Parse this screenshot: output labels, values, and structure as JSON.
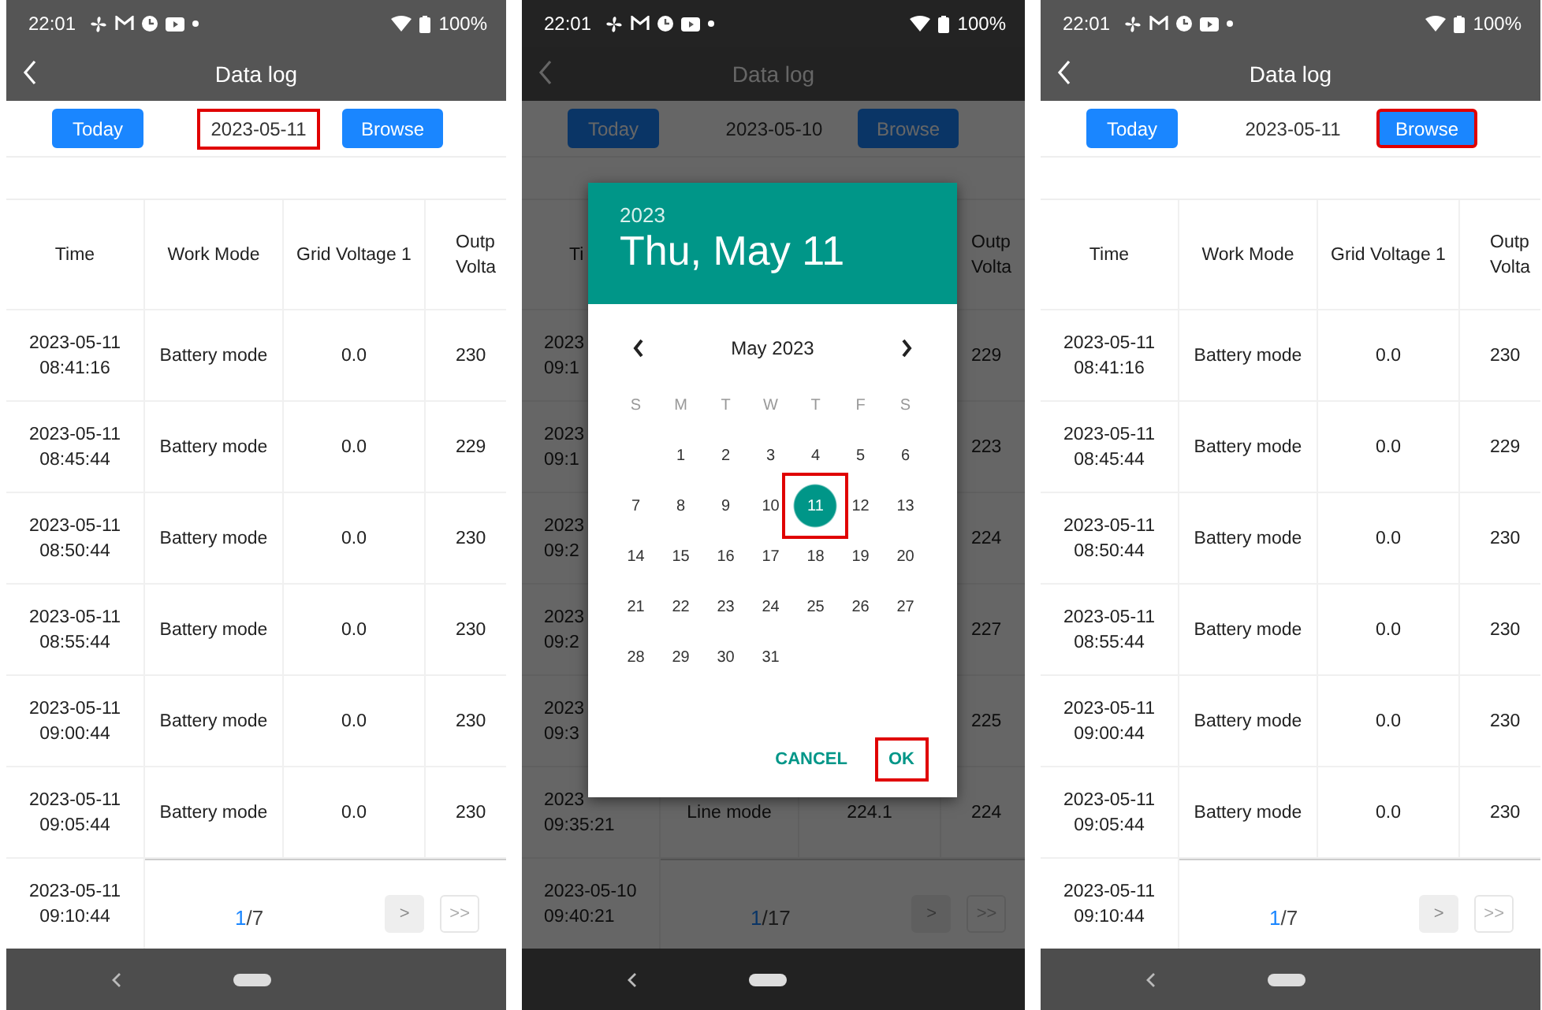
{
  "panels": [
    {
      "dimmed": false,
      "status": {
        "time": "22:01",
        "battery": "100%"
      },
      "title": "Data log",
      "toolbar": {
        "today": "Today",
        "date": "2023-05-11",
        "date_highlighted": true,
        "browse": "Browse",
        "browse_highlighted": false
      },
      "header": {
        "time": "Time",
        "work_mode": "Work Mode",
        "grid_voltage_1": "Grid Voltage 1",
        "output_voltage": [
          "Outp",
          "Volta"
        ]
      },
      "rows": [
        {
          "time": [
            "2023-05-11",
            "08:41:16"
          ],
          "work_mode": "Battery mode",
          "grid_voltage_1": "0.0",
          "output_voltage": "230"
        },
        {
          "time": [
            "2023-05-11",
            "08:45:44"
          ],
          "work_mode": "Battery mode",
          "grid_voltage_1": "0.0",
          "output_voltage": "229"
        },
        {
          "time": [
            "2023-05-11",
            "08:50:44"
          ],
          "work_mode": "Battery mode",
          "grid_voltage_1": "0.0",
          "output_voltage": "230"
        },
        {
          "time": [
            "2023-05-11",
            "08:55:44"
          ],
          "work_mode": "Battery mode",
          "grid_voltage_1": "0.0",
          "output_voltage": "230"
        },
        {
          "time": [
            "2023-05-11",
            "09:00:44"
          ],
          "work_mode": "Battery mode",
          "grid_voltage_1": "0.0",
          "output_voltage": "230"
        },
        {
          "time": [
            "2023-05-11",
            "09:05:44"
          ],
          "work_mode": "Battery mode",
          "grid_voltage_1": "0.0",
          "output_voltage": "230"
        }
      ],
      "last_row": {
        "time": [
          "2023-05-11",
          "09:10:44"
        ]
      },
      "pagination": {
        "current": "1",
        "total": "/7",
        "next": ">",
        "last": ">>"
      }
    },
    {
      "dimmed": true,
      "status": {
        "time": "22:01",
        "battery": "100%"
      },
      "title": "Data log",
      "toolbar": {
        "today": "Today",
        "date": "2023-05-10",
        "date_highlighted": false,
        "browse": "Browse",
        "browse_highlighted": false
      },
      "header": {
        "time": "Ti",
        "output_voltage": [
          "Outp",
          "Volta"
        ]
      },
      "rows": [
        {
          "time": [
            "2023",
            "09:1"
          ],
          "output_voltage": "229"
        },
        {
          "time": [
            "2023",
            "09:1"
          ],
          "output_voltage": "223"
        },
        {
          "time": [
            "2023",
            "09:2"
          ],
          "output_voltage": "224"
        },
        {
          "time": [
            "2023",
            "09:2"
          ],
          "output_voltage": "227"
        },
        {
          "time": [
            "2023",
            "09:3"
          ],
          "output_voltage": "225"
        },
        {
          "time": [
            "2023",
            "09:35:21"
          ],
          "work_mode": "Line mode",
          "grid_voltage_1": "224.1",
          "output_voltage": "224"
        }
      ],
      "last_row": {
        "time": [
          "2023-05-10",
          "09:40:21"
        ]
      },
      "pagination": {
        "current": "1",
        "total": "/17",
        "next": ">",
        "last": ">>"
      },
      "dialog": {
        "year": "2023",
        "date": "Thu, May 11",
        "month": "May 2023",
        "weekdays": [
          "S",
          "M",
          "T",
          "W",
          "T",
          "F",
          "S"
        ],
        "days": [
          {
            "label": "1",
            "selected": false,
            "highlighted": false
          },
          {
            "label": "2",
            "selected": false,
            "highlighted": false
          },
          {
            "label": "3",
            "selected": false,
            "highlighted": false
          },
          {
            "label": "4",
            "selected": false,
            "highlighted": false
          },
          {
            "label": "5",
            "selected": false,
            "highlighted": false
          },
          {
            "label": "6",
            "selected": false,
            "highlighted": false
          },
          {
            "label": "7",
            "selected": false,
            "highlighted": false
          },
          {
            "label": "8",
            "selected": false,
            "highlighted": false
          },
          {
            "label": "9",
            "selected": false,
            "highlighted": false
          },
          {
            "label": "10",
            "selected": false,
            "highlighted": false
          },
          {
            "label": "11",
            "selected": true,
            "highlighted": true
          },
          {
            "label": "12",
            "selected": false,
            "highlighted": false
          },
          {
            "label": "13",
            "selected": false,
            "highlighted": false
          },
          {
            "label": "14",
            "selected": false,
            "highlighted": false
          },
          {
            "label": "15",
            "selected": false,
            "highlighted": false
          },
          {
            "label": "16",
            "selected": false,
            "highlighted": false
          },
          {
            "label": "17",
            "selected": false,
            "highlighted": false
          },
          {
            "label": "18",
            "selected": false,
            "highlighted": false
          },
          {
            "label": "19",
            "selected": false,
            "highlighted": false
          },
          {
            "label": "20",
            "selected": false,
            "highlighted": false
          },
          {
            "label": "21",
            "selected": false,
            "highlighted": false
          },
          {
            "label": "22",
            "selected": false,
            "highlighted": false
          },
          {
            "label": "23",
            "selected": false,
            "highlighted": false
          },
          {
            "label": "24",
            "selected": false,
            "highlighted": false
          },
          {
            "label": "25",
            "selected": false,
            "highlighted": false
          },
          {
            "label": "26",
            "selected": false,
            "highlighted": false
          },
          {
            "label": "27",
            "selected": false,
            "highlighted": false
          },
          {
            "label": "28",
            "selected": false,
            "highlighted": false
          },
          {
            "label": "29",
            "selected": false,
            "highlighted": false
          },
          {
            "label": "30",
            "selected": false,
            "highlighted": false
          },
          {
            "label": "31",
            "selected": false,
            "highlighted": false
          }
        ],
        "buttons": [
          {
            "label": "CANCEL",
            "highlighted": false
          },
          {
            "label": "OK",
            "highlighted": true
          }
        ]
      }
    },
    {
      "dimmed": false,
      "status": {
        "time": "22:01",
        "battery": "100%"
      },
      "title": "Data log",
      "toolbar": {
        "today": "Today",
        "date": "2023-05-11",
        "date_highlighted": false,
        "browse": "Browse",
        "browse_highlighted": true
      },
      "header": {
        "time": "Time",
        "work_mode": "Work Mode",
        "grid_voltage_1": "Grid Voltage 1",
        "output_voltage": [
          "Outp",
          "Volta"
        ]
      },
      "rows": [
        {
          "time": [
            "2023-05-11",
            "08:41:16"
          ],
          "work_mode": "Battery mode",
          "grid_voltage_1": "0.0",
          "output_voltage": "230"
        },
        {
          "time": [
            "2023-05-11",
            "08:45:44"
          ],
          "work_mode": "Battery mode",
          "grid_voltage_1": "0.0",
          "output_voltage": "229"
        },
        {
          "time": [
            "2023-05-11",
            "08:50:44"
          ],
          "work_mode": "Battery mode",
          "grid_voltage_1": "0.0",
          "output_voltage": "230"
        },
        {
          "time": [
            "2023-05-11",
            "08:55:44"
          ],
          "work_mode": "Battery mode",
          "grid_voltage_1": "0.0",
          "output_voltage": "230"
        },
        {
          "time": [
            "2023-05-11",
            "09:00:44"
          ],
          "work_mode": "Battery mode",
          "grid_voltage_1": "0.0",
          "output_voltage": "230"
        },
        {
          "time": [
            "2023-05-11",
            "09:05:44"
          ],
          "work_mode": "Battery mode",
          "grid_voltage_1": "0.0",
          "output_voltage": "230"
        }
      ],
      "last_row": {
        "time": [
          "2023-05-11",
          "09:10:44"
        ]
      },
      "pagination": {
        "current": "1",
        "total": "/7",
        "next": ">",
        "last": ">>"
      }
    }
  ]
}
